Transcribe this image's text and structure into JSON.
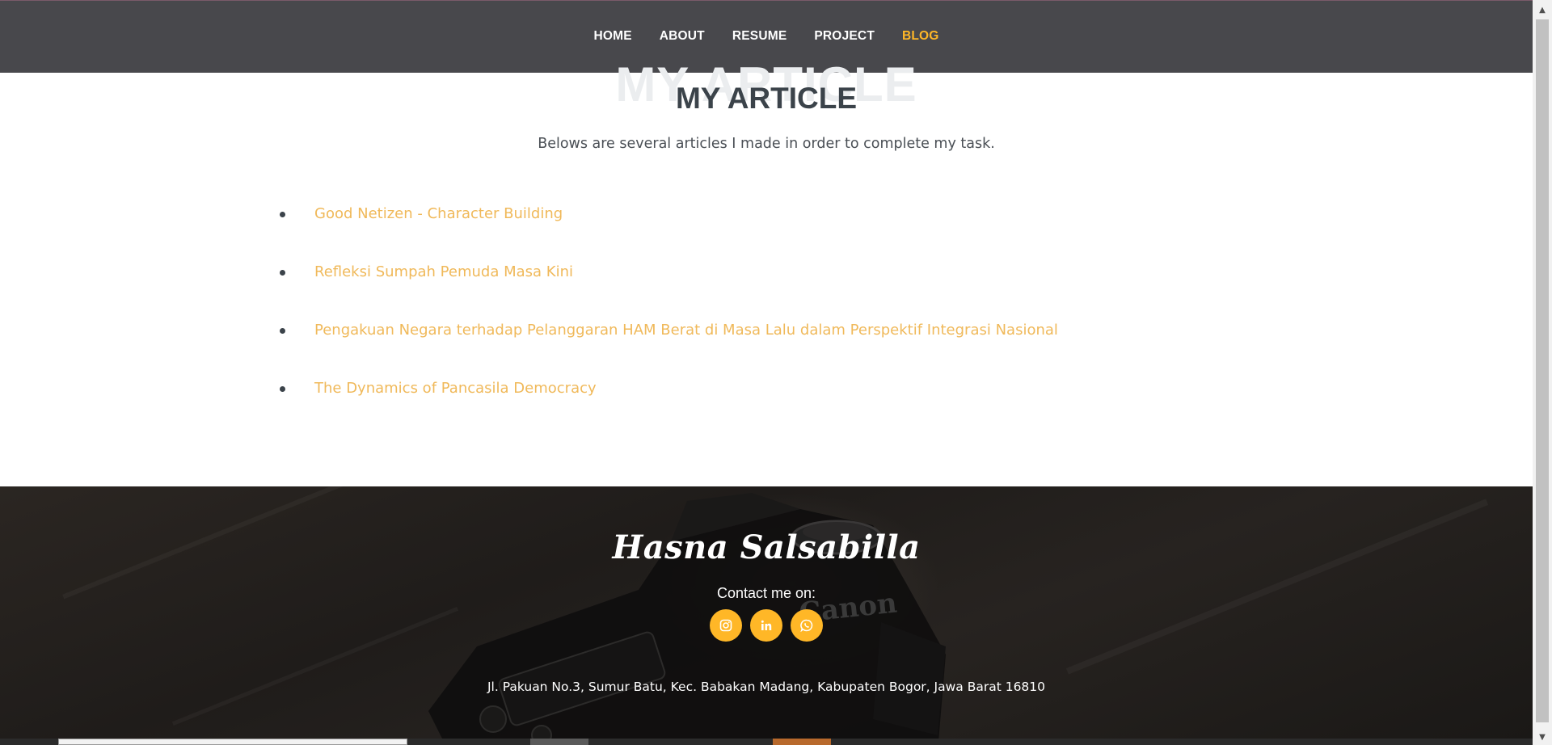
{
  "nav": {
    "items": [
      {
        "label": "HOME",
        "active": false
      },
      {
        "label": "ABOUT",
        "active": false
      },
      {
        "label": "RESUME",
        "active": false
      },
      {
        "label": "PROJECT",
        "active": false
      },
      {
        "label": "BLOG",
        "active": true
      }
    ],
    "active_color": "#ffb727"
  },
  "section": {
    "ghost_title": "MY ARTICLE",
    "title": "MY ARTICLE",
    "subtitle": "Belows are several articles I made in order to complete my task."
  },
  "articles": [
    {
      "title": "Good Netizen - Character Building"
    },
    {
      "title": "Refleksi Sumpah Pemuda Masa Kini"
    },
    {
      "title": "Pengakuan Negara terhadap Pelanggaran HAM Berat di Masa Lalu dalam Perspektif Integrasi Nasional"
    },
    {
      "title": "The Dynamics of Pancasila Democracy"
    }
  ],
  "footer": {
    "brand": "Hasna Salsabilla",
    "contact_label": "Contact me on:",
    "socials": [
      {
        "icon": "instagram-icon"
      },
      {
        "icon": "linkedin-icon"
      },
      {
        "icon": "whatsapp-icon"
      }
    ],
    "address": "Jl. Pakuan No.3, Sumur Batu, Kec. Babakan Madang, Kabupaten Bogor, Jawa Barat 16810",
    "camera_label": "Canon",
    "accent_color": "#ffb727"
  }
}
